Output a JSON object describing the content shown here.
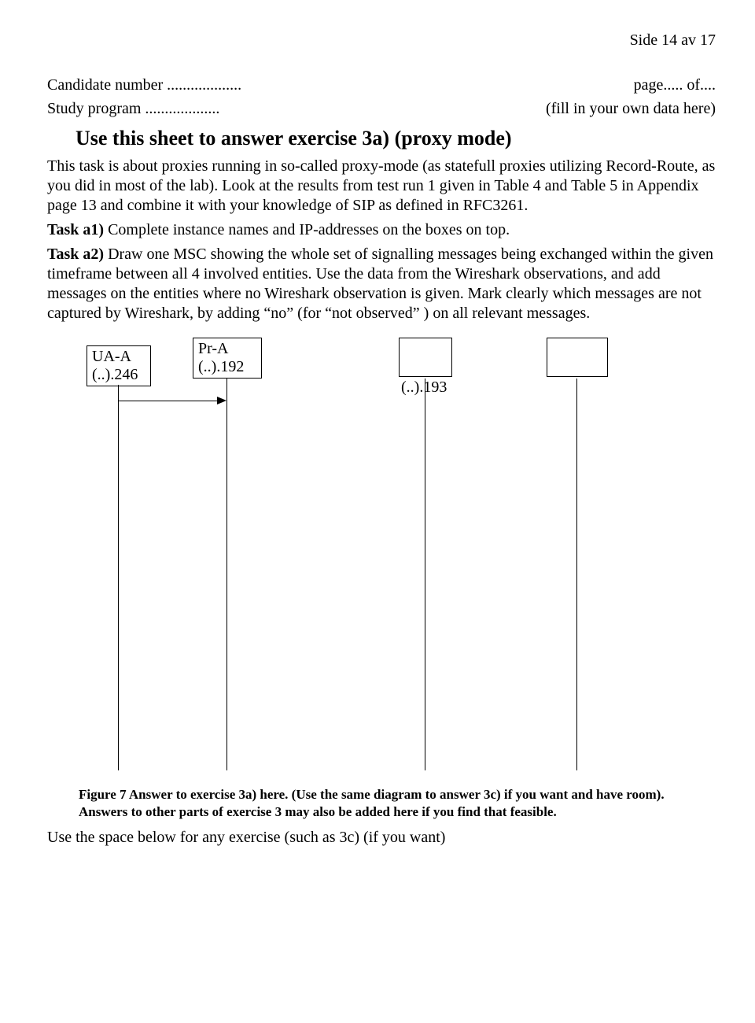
{
  "page_header": "Side 14 av 17",
  "header": {
    "candidate_line": "Candidate number ...................",
    "study_line": "Study program ...................",
    "page_of": "page..... of....",
    "fill_note": "(fill in your own data here)"
  },
  "title": "Use this sheet to answer exercise 3a) (proxy mode)",
  "intro": "This task is about proxies running in so-called proxy-mode (as statefull proxies utilizing Record-Route, as you did in most of the lab). Look at the results from test run 1 given in Table 4 and Table 5 in Appendix page 13 and combine it with your knowledge of SIP as defined in RFC3261.",
  "task_a1_label": "Task a1)",
  "task_a1_text": " Complete instance names and IP-addresses on the boxes on top.",
  "task_a2_label": "Task a2)",
  "task_a2_text": " Draw one MSC showing the whole set of signalling messages being exchanged within the given timeframe between all 4 involved entities. Use the data from the Wireshark observations, and add messages on the entities where no Wireshark observation is given. Mark clearly which messages are not captured by Wireshark, by adding “no” (for “not observed” ) on all relevant messages.",
  "diagram": {
    "box1_name": "UA-A",
    "box1_ip": "(..).246",
    "box2_name": "Pr-A",
    "box2_ip": "(..).192",
    "box3_ip": "(..).193"
  },
  "caption": "Figure 7 Answer to exercise 3a) here. (Use the same diagram to answer 3c) if you want and have room). Answers to other parts of exercise 3 may also be added here if you find that feasible.",
  "footer": "Use the space below for any exercise (such as 3c) (if you want)"
}
